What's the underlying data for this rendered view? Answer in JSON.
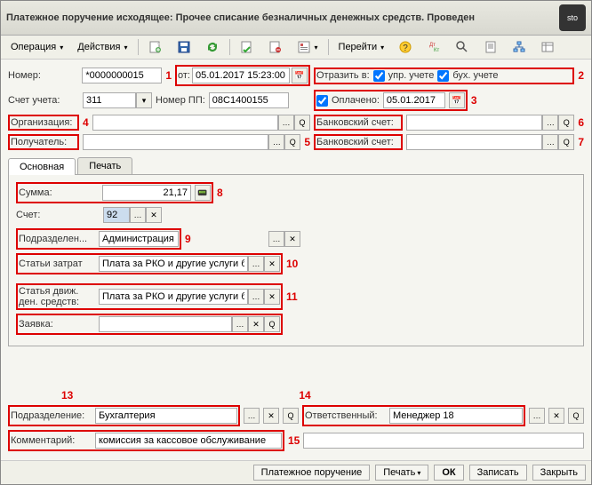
{
  "title": "Платежное поручение исходящее: Прочее списание безналичных денежных средств. Проведен",
  "toolbar": {
    "operation": "Операция",
    "actions": "Действия",
    "goto": "Перейти"
  },
  "fields": {
    "number_label": "Номер:",
    "number_value": "*0000000015",
    "from_label": "от:",
    "date_value": "05.01.2017 15:23:00",
    "reflect_label": "Отразить в:",
    "upr_label": "упр. учете",
    "buh_label": "бух. учете",
    "account_label": "Счет учета:",
    "account_value": "311",
    "pp_label": "Номер ПП:",
    "pp_value": "08С1400155",
    "paid_label": "Оплачено:",
    "paid_date": "05.01.2017",
    "org_label": "Организация:",
    "org_value": "",
    "bank1_label": "Банковский счет:",
    "bank1_value": "",
    "recipient_label": "Получатель:",
    "recipient_value": "",
    "bank2_label": "Банковский счет:",
    "bank2_value": ""
  },
  "tabs": {
    "main": "Основная",
    "print": "Печать"
  },
  "main_tab": {
    "sum_label": "Сумма:",
    "sum_value": "21,17",
    "schet_label": "Счет:",
    "schet_value": "92",
    "podrazd_label": "Подразделен...",
    "podrazd_value": "Администрация",
    "cost_label": "Статьи затрат",
    "cost_value": "Плата за РКО и другие услуги банко",
    "move_label1": "Статья движ.",
    "move_label2": "ден. средств:",
    "move_value": "Плата за РКО и другие услуги банко",
    "request_label": "Заявка:",
    "request_value": ""
  },
  "bottom": {
    "podrazd_label": "Подразделение:",
    "podrazd_value": "Бухгалтерия",
    "resp_label": "Ответственный:",
    "resp_value": "Менеджер 18",
    "comment_label": "Комментарий:",
    "comment_value": "комиссия за кассовое обслуживание"
  },
  "footer": {
    "pp": "Платежное поручение",
    "print": "Печать",
    "ok": "ОК",
    "save": "Записать",
    "close": "Закрыть"
  },
  "nums": {
    "n1": "1",
    "n2": "2",
    "n3": "3",
    "n4": "4",
    "n5": "5",
    "n6": "6",
    "n7": "7",
    "n8": "8",
    "n9": "9",
    "n10": "10",
    "n11": "11",
    "n13": "13",
    "n14": "14",
    "n15": "15"
  }
}
